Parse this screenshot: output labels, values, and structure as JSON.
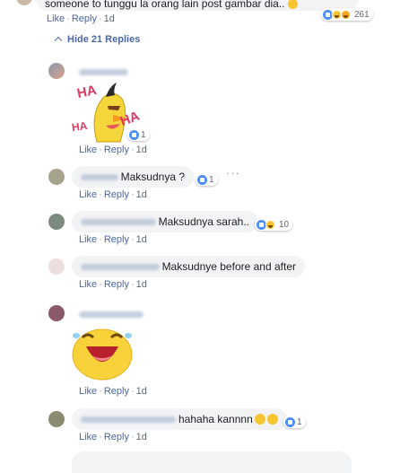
{
  "top_comment": {
    "text": "someone to tunggu la orang lain post gambar dia..",
    "reaction_count": "261",
    "like_label": "Like",
    "reply_label": "Reply",
    "time": "1d"
  },
  "hide_replies_label": "Hide 21 Replies",
  "replies": [
    {
      "text": "",
      "reaction_count": "1",
      "time": "1d",
      "sticker": "chuck-haha-sticker"
    },
    {
      "text": "Maksudnya ?",
      "reaction_count": "1",
      "time": "1d"
    },
    {
      "text": "Maksudnya sarah..",
      "reaction_count": "10",
      "time": "1d"
    },
    {
      "text": "Maksudnye before and after",
      "time": "1d"
    },
    {
      "text": "",
      "time": "1d",
      "sticker": "laughing-face-sticker"
    },
    {
      "text": "hahaha kannnn",
      "reaction_count": "1",
      "time": "1d"
    }
  ],
  "action_labels": {
    "like": "Like",
    "reply": "Reply"
  },
  "sticker_text": {
    "ha1": "HA",
    "ha2": "HA",
    "ha3": "HA"
  },
  "colors": {
    "link": "#4b67a1",
    "bubble": "#f2f3f5",
    "like": "#4d8ef7",
    "haha": "#f7c52f"
  }
}
